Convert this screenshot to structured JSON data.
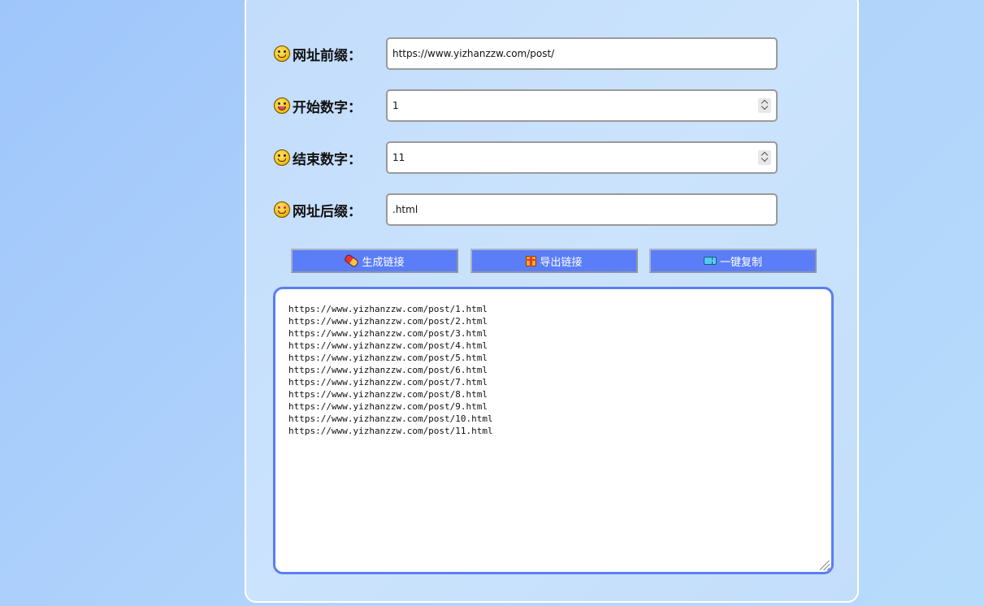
{
  "form": {
    "prefix": {
      "label": "网址前缀：",
      "icon": "grinning-face-icon",
      "value": "https://www.yizhanzzw.com/post/"
    },
    "start": {
      "label": "开始数字：",
      "icon": "tongue-face-icon",
      "value": "1"
    },
    "end": {
      "label": "结束数字：",
      "icon": "yum-face-icon",
      "value": "11"
    },
    "suffix": {
      "label": "网址后缀：",
      "icon": "smiling-hearts-face-icon",
      "value": ".html"
    }
  },
  "buttons": {
    "generate": {
      "label": "生成链接",
      "icon": "pill-icon"
    },
    "export": {
      "label": "导出链接",
      "icon": "gift-icon"
    },
    "copy": {
      "label": "一键复制",
      "icon": "ticket-icon"
    }
  },
  "output": {
    "lines": [
      "https://www.yizhanzzw.com/post/1.html",
      "https://www.yizhanzzw.com/post/2.html",
      "https://www.yizhanzzw.com/post/3.html",
      "https://www.yizhanzzw.com/post/4.html",
      "https://www.yizhanzzw.com/post/5.html",
      "https://www.yizhanzzw.com/post/6.html",
      "https://www.yizhanzzw.com/post/7.html",
      "https://www.yizhanzzw.com/post/8.html",
      "https://www.yizhanzzw.com/post/9.html",
      "https://www.yizhanzzw.com/post/10.html",
      "https://www.yizhanzzw.com/post/11.html"
    ]
  },
  "colors": {
    "button": "#5b7ef8",
    "output_border": "#5b7ef3",
    "card_border": "#ffffff"
  }
}
